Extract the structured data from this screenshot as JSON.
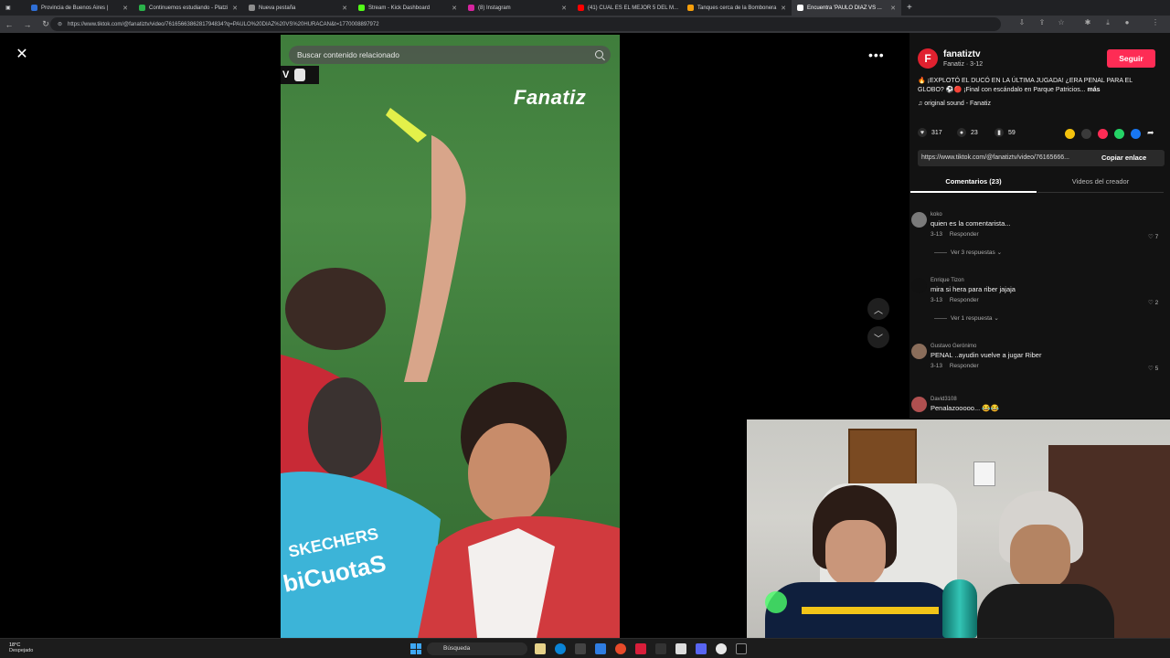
{
  "browser": {
    "tabs": [
      {
        "title": "Provincia de Buenos Aires |",
        "color": "#2f6fd6"
      },
      {
        "title": "Continuemos estudiando - Platzi",
        "color": "#2ab24a"
      },
      {
        "title": "Nueva pestaña",
        "color": "#8e8e8e"
      },
      {
        "title": "Stream - Kick Dashboard",
        "color": "#53fc18"
      },
      {
        "title": "(8) Instagram",
        "color": "#d6249f"
      },
      {
        "title": "(41) CUAL ES EL MEJOR 5 DEL M...",
        "color": "#ff0000"
      },
      {
        "title": "Tanques cerca de la Bombonera",
        "color": "#f59e0b"
      },
      {
        "title": "Encuentra 'PAULO DIAZ VS ...",
        "color": "#ffffff"
      }
    ],
    "url": "https://www.tiktok.com/@fanatiztv/video/7616566386281794834?q=PAULO%20DIAZ%20VS%20HURACAN&t=1770008897972"
  },
  "video": {
    "search_placeholder": "Buscar contenido relacionado",
    "watermark": "Fanatiz",
    "badge": "V"
  },
  "creator": {
    "name": "fanatiztv",
    "subtitle": "Fanatiz · 3-12",
    "follow_label": "Seguir",
    "description": "🔥 ¡EXPLOTÓ EL DUCÓ EN LA ÚLTIMA JUGADA! ¿ERA PENAL PARA EL GLOBO? ⚽🔴 ¡Final con escándalo en Parque Patricios...",
    "more_label": "más",
    "sound": "♫  original sound - Fanatiz"
  },
  "actions": {
    "likes": "317",
    "comments": "23",
    "saves": "59"
  },
  "link": {
    "url": "https://www.tiktok.com/@fanatiztv/video/76165666...",
    "copy_label": "Copiar enlace"
  },
  "tabs": {
    "comments": "Comentarios (23)",
    "creator_videos": "Videos del creador"
  },
  "comments": [
    {
      "user": "koko",
      "text": "quien es la comentarista...",
      "date": "3-13",
      "reply": "Responder",
      "likes": "7",
      "replies": "Ver 3 respuestas ⌄",
      "avatar_color": "#7a7a7a"
    },
    {
      "user": "Enrique Tizon",
      "text": "mira si hera para riber jajaja",
      "date": "3-13",
      "reply": "Responder",
      "likes": "2",
      "replies": "Ver 1 respuesta ⌄",
      "avatar_color": "#111111"
    },
    {
      "user": "Gustavo Gerónimo",
      "text": "PENAL ..ayudin vuelve a jugar Riber",
      "date": "3-13",
      "reply": "Responder",
      "likes": "5",
      "replies": "",
      "avatar_color": "#8a6d5a"
    },
    {
      "user": "David3108",
      "text": "Penalazooooo... 😂😂",
      "date": "",
      "reply": "",
      "likes": "",
      "replies": "",
      "avatar_color": "#b05050"
    }
  ],
  "taskbar": {
    "weather_temp": "18°C",
    "weather_desc": "Despejado",
    "search_label": "Búsqueda"
  },
  "colors": {
    "accent": "#fe2c55",
    "panel_bg": "#121212"
  }
}
